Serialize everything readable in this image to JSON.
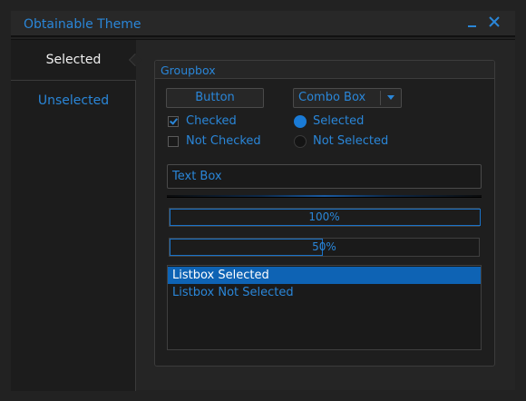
{
  "window": {
    "title": "Obtainable Theme",
    "minimize_icon": "minimize-icon",
    "close_icon": "close-icon"
  },
  "tabs": [
    {
      "label": "Selected",
      "selected": true
    },
    {
      "label": "Unselected",
      "selected": false
    }
  ],
  "groupbox": {
    "title": "Groupbox",
    "button_label": "Button",
    "combo": {
      "value": "Combo Box",
      "arrow_icon": "chevron-down-icon"
    },
    "checkboxes": [
      {
        "label": "Checked",
        "checked": true
      },
      {
        "label": "Not Checked",
        "checked": false
      }
    ],
    "radios": [
      {
        "label": "Selected",
        "selected": true
      },
      {
        "label": "Not Selected",
        "selected": false
      }
    ],
    "textbox_value": "Text Box",
    "progress": [
      {
        "value": 100,
        "label": "100%"
      },
      {
        "value": 50,
        "label": "50%"
      }
    ],
    "listbox": [
      {
        "label": "Listbox Selected",
        "selected": true
      },
      {
        "label": "Listbox Not Selected",
        "selected": false
      }
    ]
  },
  "colors": {
    "accent": "#2a86d8",
    "selection": "#0e63b4",
    "background": "#222222"
  }
}
